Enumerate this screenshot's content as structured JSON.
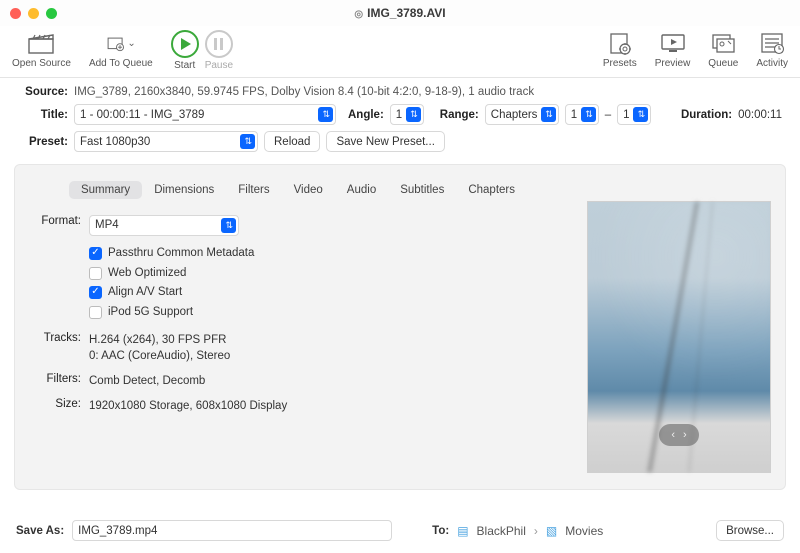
{
  "window": {
    "title": "IMG_3789.AVI"
  },
  "toolbar": {
    "open_source": "Open Source",
    "add_to_queue": "Add To Queue",
    "start": "Start",
    "pause": "Pause",
    "presets": "Presets",
    "preview": "Preview",
    "queue": "Queue",
    "activity": "Activity"
  },
  "meta": {
    "source_label": "Source:",
    "source_value": "IMG_3789, 2160x3840, 59.9745 FPS, Dolby Vision 8.4 (10-bit 4:2:0, 9-18-9), 1 audio track",
    "title_label": "Title:",
    "title_value": "1 - 00:00:11 - IMG_3789",
    "angle_label": "Angle:",
    "angle_value": "1",
    "range_label": "Range:",
    "range_type": "Chapters",
    "range_from": "1",
    "range_sep": "–",
    "range_to": "1",
    "duration_label": "Duration:",
    "duration_value": "00:00:11",
    "preset_label": "Preset:",
    "preset_value": "Fast 1080p30",
    "reload": "Reload",
    "save_new_preset": "Save New Preset..."
  },
  "tabs": {
    "summary": "Summary",
    "dimensions": "Dimensions",
    "filters": "Filters",
    "video": "Video",
    "audio": "Audio",
    "subtitles": "Subtitles",
    "chapters": "Chapters"
  },
  "summary": {
    "format_label": "Format:",
    "format_value": "MP4",
    "opt_passthru": "Passthru Common Metadata",
    "opt_web": "Web Optimized",
    "opt_align": "Align A/V Start",
    "opt_ipod": "iPod 5G Support",
    "tracks_label": "Tracks:",
    "tracks_value": "H.264 (x264), 30 FPS PFR\n0: AAC (CoreAudio), Stereo",
    "filters_label": "Filters:",
    "filters_value": "Comb Detect, Decomb",
    "size_label": "Size:",
    "size_value": "1920x1080 Storage, 608x1080 Display"
  },
  "footer": {
    "saveas_label": "Save As:",
    "saveas_value": "IMG_3789.mp4",
    "to_label": "To:",
    "path1": "BlackPhil",
    "path_sep": "›",
    "path2": "Movies",
    "browse": "Browse..."
  }
}
